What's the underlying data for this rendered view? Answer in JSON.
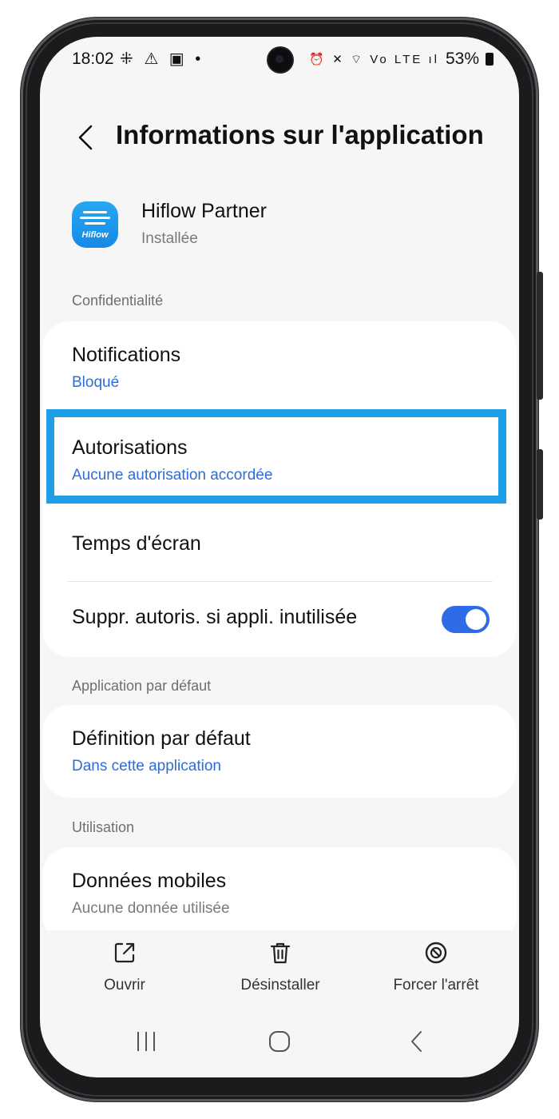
{
  "status_bar": {
    "time": "18:02",
    "left_icons": "⁜ ⚠ ▣ •",
    "right_icons": "⏰ ✕ ⌔ Vo LTE ıl",
    "battery": "53%"
  },
  "header": {
    "title": "Informations sur l'application"
  },
  "app": {
    "name": "Hiflow Partner",
    "status": "Installée",
    "icon_brand": "Hiflow"
  },
  "sections": {
    "privacy_label": "Confidentialité",
    "default_app_label": "Application par défaut",
    "usage_label": "Utilisation"
  },
  "rows": {
    "notifications": {
      "title": "Notifications",
      "value": "Bloqué"
    },
    "permissions": {
      "title": "Autorisations",
      "value": "Aucune autorisation accordée"
    },
    "screen_time": {
      "title": "Temps d'écran"
    },
    "remove_permissions": {
      "title": "Suppr. autoris. si appli. inutilisée",
      "enabled": true
    },
    "default_setting": {
      "title": "Définition par défaut",
      "value": "Dans cette application"
    },
    "mobile_data": {
      "title": "Données mobiles",
      "value": "Aucune donnée utilisée"
    }
  },
  "actions": {
    "open": "Ouvrir",
    "uninstall": "Désinstaller",
    "force_stop": "Forcer l'arrêt"
  },
  "colors": {
    "accent": "#2e6dd1",
    "highlight": "#1e9ee8",
    "toggle_on": "#2e6be6"
  }
}
